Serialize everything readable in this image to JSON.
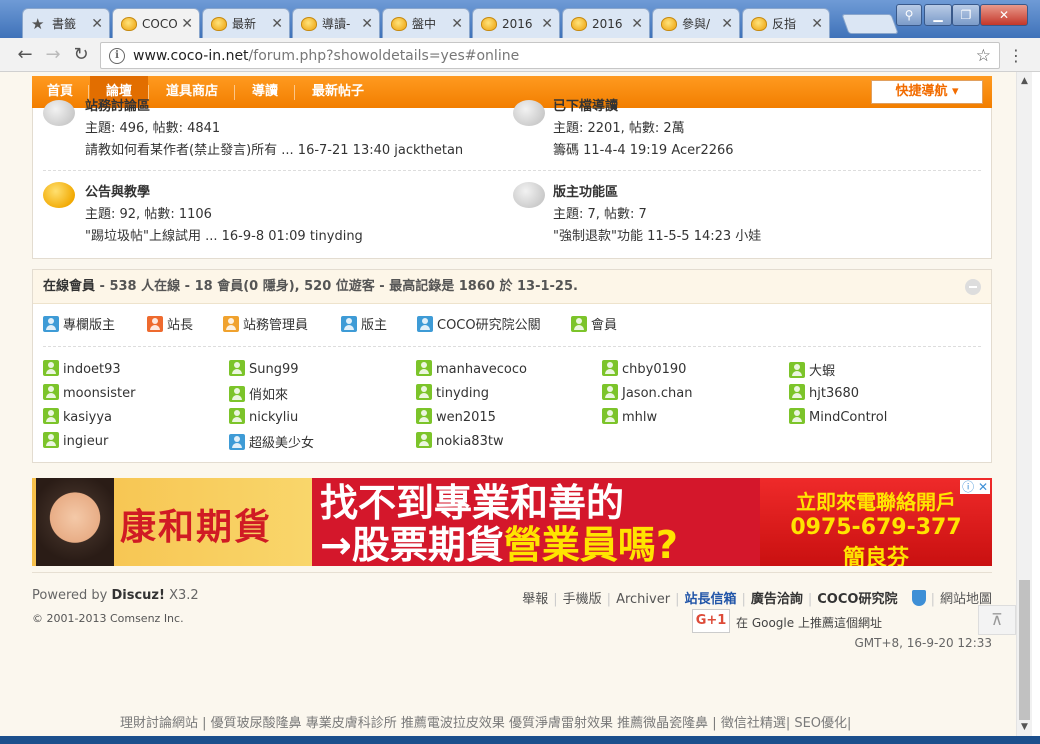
{
  "browser": {
    "tabs": [
      {
        "label": "書籤",
        "icon": "star-icon",
        "active": false
      },
      {
        "label": "COCO",
        "icon": "forum-favicon",
        "active": true
      },
      {
        "label": "最新",
        "icon": "forum-favicon",
        "active": false
      },
      {
        "label": "導讀-",
        "icon": "forum-favicon",
        "active": false
      },
      {
        "label": "盤中",
        "icon": "forum-favicon",
        "active": false
      },
      {
        "label": "2016",
        "icon": "forum-favicon",
        "active": false
      },
      {
        "label": "2016",
        "icon": "forum-favicon",
        "active": false
      },
      {
        "label": "參與/",
        "icon": "forum-favicon",
        "active": false
      },
      {
        "label": "反指",
        "icon": "forum-favicon",
        "active": false
      }
    ],
    "close_glyph": "✕",
    "url_domain": "www.coco-in.net",
    "url_path": "/forum.php?showoldetails=yes#online"
  },
  "nav": {
    "items": [
      "首頁",
      "論壇",
      "道具商店",
      "導讀",
      "最新帖子"
    ],
    "active_index": 1,
    "quick_nav": "快捷導航 ▾"
  },
  "forums": [
    {
      "title": "站務討論區",
      "stats": "主題: 496, 帖數: 4841",
      "last": "請教如何看某作者(禁止發言)所有 ... 16-7-21 13:40 jackthetan",
      "icon": "gray"
    },
    {
      "title": "已下檔導讀",
      "stats": "主題: 2201, 帖數: 2萬",
      "last": "籌碼 11-4-4 19:19 Acer2266",
      "icon": "gray"
    },
    {
      "title": "公告與教學",
      "stats": "主題: 92, 帖數: 1106",
      "last": "\"踢垃圾帖\"上線試用 ... 16-9-8 01:09 tinyding",
      "icon": "yellow"
    },
    {
      "title": "版主功能區",
      "stats": "主題: 7, 帖數: 7",
      "last": "\"強制退款\"功能 11-5-5 14:23 小娃",
      "icon": "gray"
    }
  ],
  "online": {
    "title": "在線會員",
    "stats": " - 538 人在線 - 18 會員(0 隱身), 520 位遊客 - 最高記錄是 1860 於 13-1-25.",
    "legend": [
      {
        "label": "專欄版主",
        "color": "blue"
      },
      {
        "label": "站長",
        "color": "red"
      },
      {
        "label": "站務管理員",
        "color": "orange"
      },
      {
        "label": "版主",
        "color": "blue"
      },
      {
        "label": "COCO研究院公關",
        "color": "blue"
      },
      {
        "label": "會員",
        "color": "green"
      }
    ],
    "members": [
      {
        "name": "indoet93",
        "color": "green"
      },
      {
        "name": "Sung99",
        "color": "green"
      },
      {
        "name": "manhavecoco",
        "color": "green"
      },
      {
        "name": "chby0190",
        "color": "green"
      },
      {
        "name": "大蝦",
        "color": "green"
      },
      {
        "name": "moonsister",
        "color": "green"
      },
      {
        "name": "俏如來",
        "color": "green"
      },
      {
        "name": "tinyding",
        "color": "green"
      },
      {
        "name": "Jason.chan",
        "color": "green"
      },
      {
        "name": "hjt3680",
        "color": "green"
      },
      {
        "name": "kasiyya",
        "color": "green"
      },
      {
        "name": "nickyliu",
        "color": "green"
      },
      {
        "name": "wen2015",
        "color": "green"
      },
      {
        "name": "mhlw",
        "color": "green"
      },
      {
        "name": "MindControl",
        "color": "green"
      },
      {
        "name": "ingieur",
        "color": "green"
      },
      {
        "name": "超級美少女",
        "color": "blue"
      },
      {
        "name": "nokia83tw",
        "color": "green"
      }
    ]
  },
  "ad": {
    "brand": "康和期貨",
    "line1": "找不到專業和善的",
    "line2_pre": "→股票期貨",
    "line2_hl": "營業員嗎?",
    "cta": "立即來電聯絡開戶",
    "phone": "0975-679-377",
    "agent": "簡良芬",
    "controls": "ⓘ ✕"
  },
  "footer": {
    "powered_prefix": "Powered by ",
    "powered_name": "Discuz!",
    "powered_version": " X3.2",
    "copyright": "© 2001-2013 Comsenz Inc.",
    "links": [
      "舉報",
      "手機版",
      "Archiver",
      "站長信箱",
      "廣告洽詢",
      "COCO研究院",
      "網站地圖"
    ],
    "gplus_label": "G+1",
    "gplus_text": "在 Google 上推薦這個網址",
    "gmt": "GMT+8, 16-9-20 12:33",
    "bottom": "理財討論網站 | 優質玻尿酸隆鼻 專業皮膚科診所 推薦電波拉皮效果 優質淨膚雷射效果 推薦微晶瓷隆鼻 | 徵信社精選| SEO優化|"
  }
}
